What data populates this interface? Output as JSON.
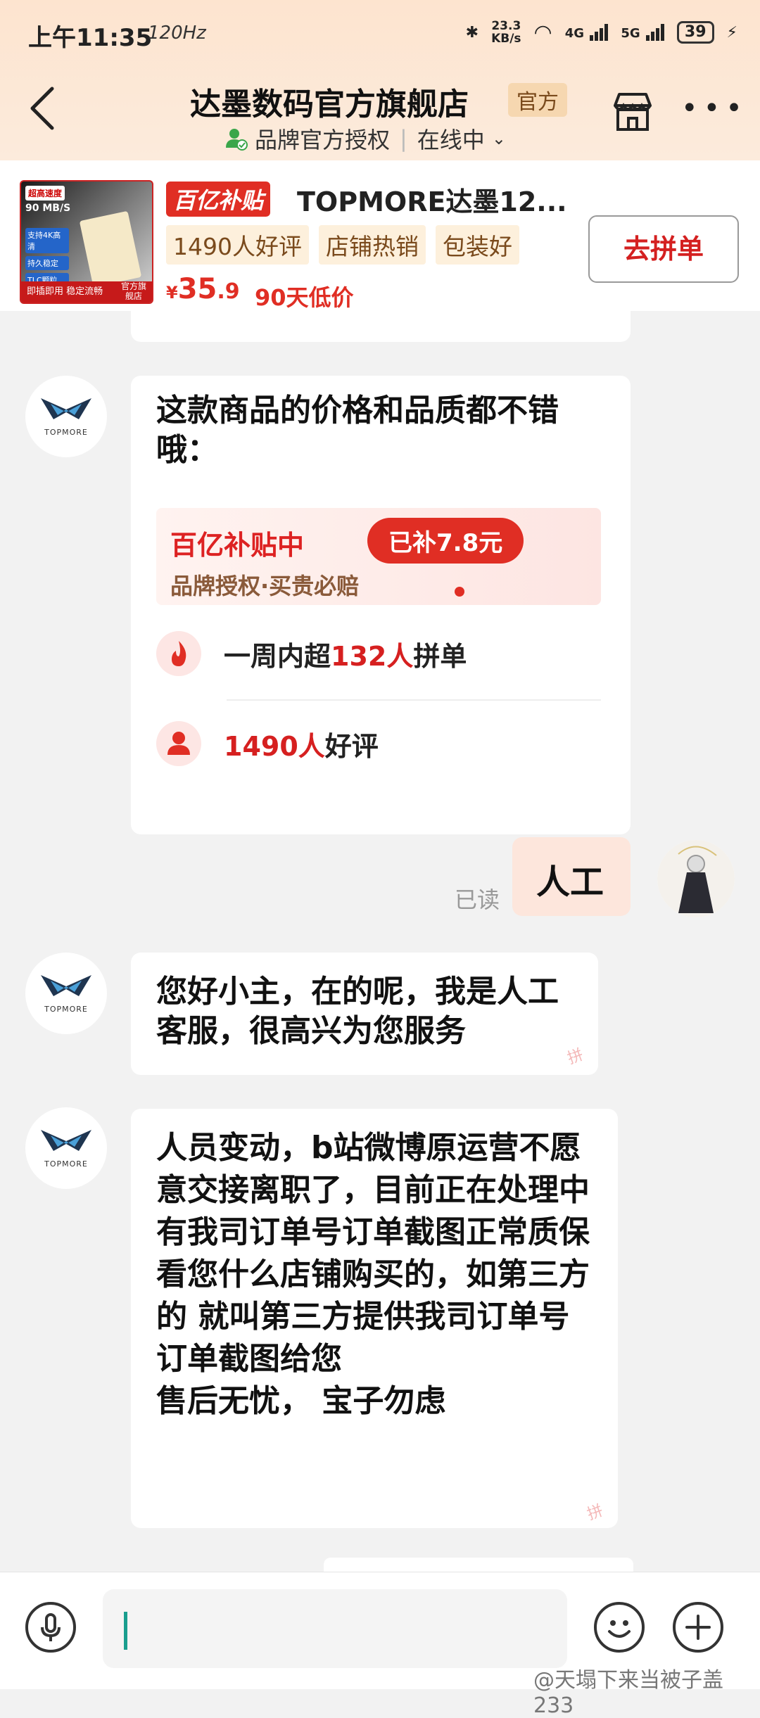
{
  "status_bar": {
    "time": "上午11:35",
    "refresh": "120Hz",
    "net_speed_value": "23.3",
    "net_speed_unit": "KB/s",
    "sig1": "4G",
    "sig2": "5G",
    "battery": "39"
  },
  "header": {
    "shop_name": "达墨数码官方旗舰店",
    "official_badge": "官方",
    "auth_text": "品牌官方授权",
    "online_text": "在线中"
  },
  "product": {
    "thumb_top": "超高速度",
    "thumb_speed": "90 MB/S",
    "thumb_features": [
      "支持4K高清",
      "持久稳定",
      "TLC颗粒"
    ],
    "thumb_bottom": "即插即用  稳定流畅",
    "thumb_corner": "官方旗舰店",
    "subsidy_tag": "百亿补贴",
    "name": "TOPMORE达墨12...",
    "tags": [
      "1490人好评",
      "店铺热销",
      "包装好"
    ],
    "price_currency": "¥",
    "price_int": "35",
    "price_dec": ".9",
    "low_price": "90天低价",
    "group_button": "去拼单"
  },
  "messages": {
    "m1_text": "这款商品的价格和品质都不错哦：",
    "promo_title": "百亿补贴中",
    "promo_sub": "品牌授权·买贵必赔",
    "promo_pill": "已补7.8元",
    "stat1_pre": "一周内超",
    "stat1_hl": "132人",
    "stat1_post": "拼单",
    "stat2_hl": "1490人",
    "stat2_post": "好评",
    "logo_text": "TOPMORE",
    "read_label": "已读",
    "my_text": "人工",
    "m2_text": "您好小主，在的呢，我是人工客服，很高兴为您服务",
    "m3_text": "人员变动，b站微博原运营不愿意交接离职了，目前正在处理中\n有我司订单号订单截图正常质保\n看您什么店铺购买的，如第三方的 就叫第三方提供我司订单号订单截图给您\n售后无忧， 宝子勿虑",
    "bubble_wm": "拼"
  },
  "input": {
    "watermark": "@天塌下来当被子盖233"
  },
  "colors": {
    "accent_red": "#e02e24",
    "header_bg": "#fde4cf",
    "caret": "#1a9e8e"
  }
}
